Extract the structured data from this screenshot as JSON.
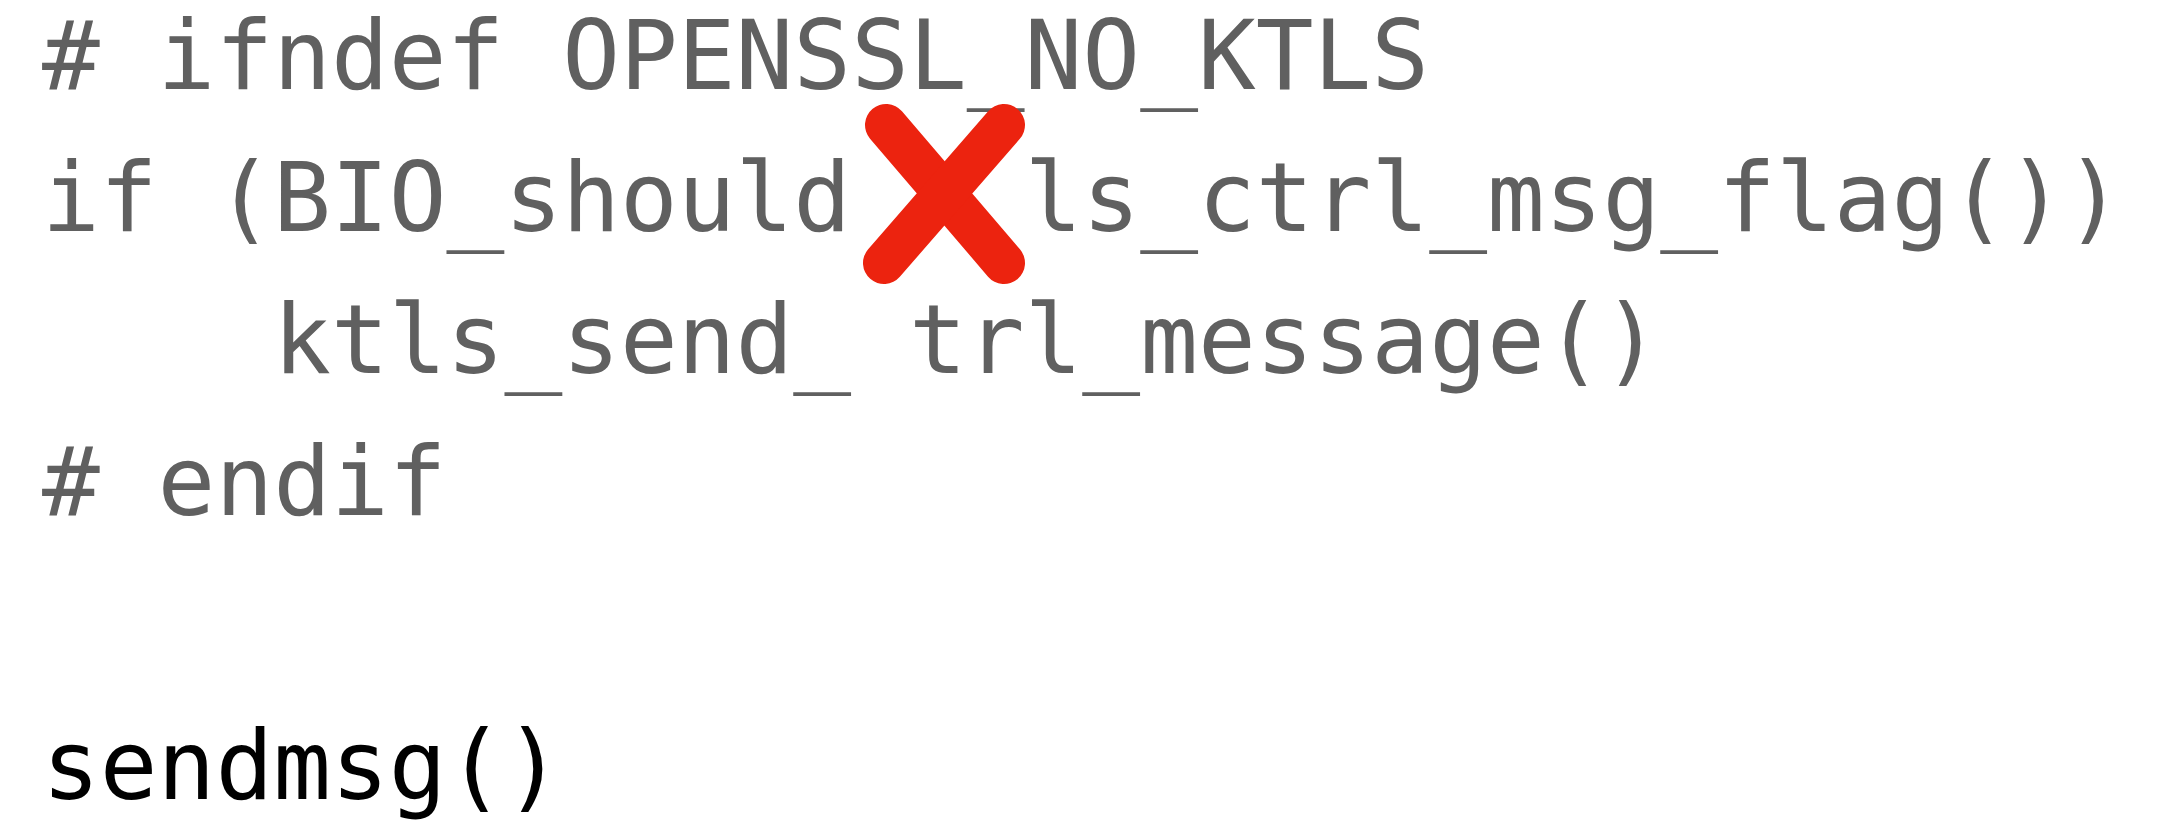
{
  "blocks": [
    {
      "dimmed": true,
      "crossed_out": true,
      "lines": [
        [
          "# ifndef OPENSSL_NO_KTLS"
        ],
        [
          "if (BIO_should",
          "ls_ctrl_msg_flag())"
        ],
        [
          "    ktls_send_",
          "trl_message()"
        ],
        [
          "# endif"
        ]
      ]
    },
    {
      "dimmed": false,
      "crossed_out": false,
      "lines": [
        [
          "sendmsg()"
        ]
      ]
    }
  ]
}
